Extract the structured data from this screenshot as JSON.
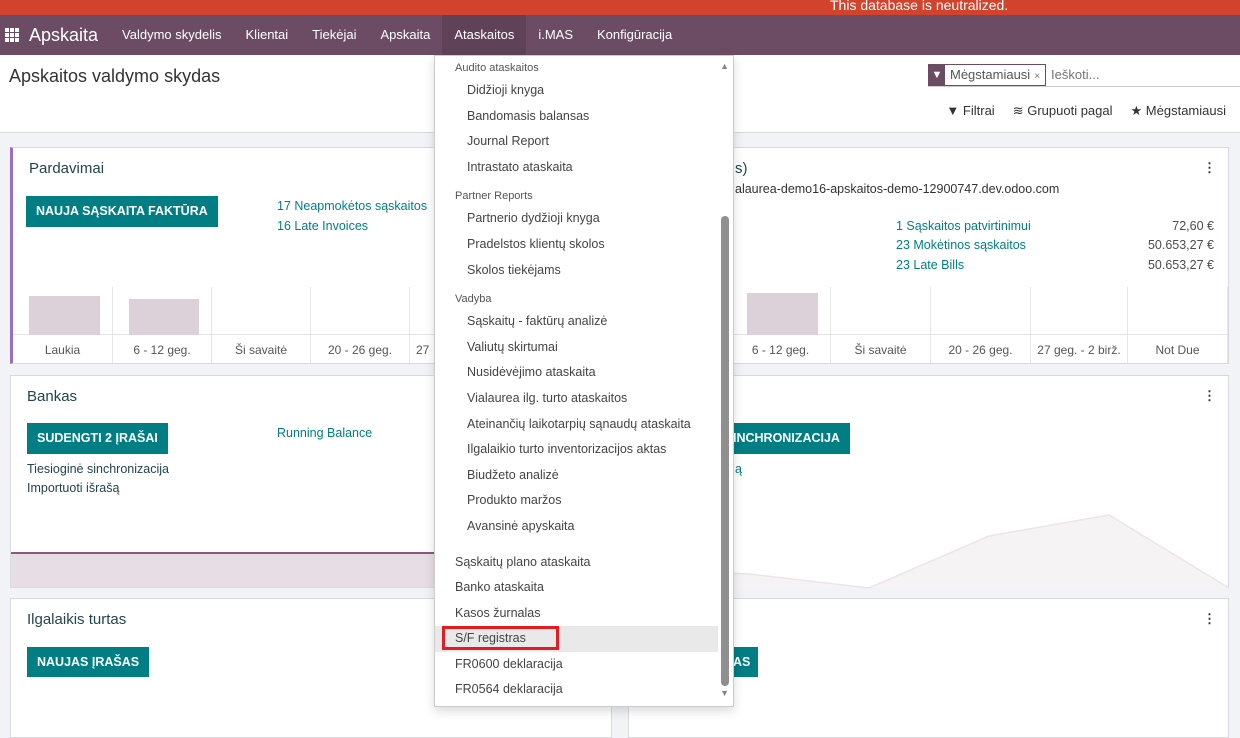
{
  "banner": "This database is neutralized.",
  "nav": {
    "brand": "Apskaita",
    "items": [
      "Valdymo skydelis",
      "Klientai",
      "Tiekėjai",
      "Apskaita",
      "Ataskaitos",
      "i.MAS",
      "Konfigūracija"
    ],
    "active": "Ataskaitos"
  },
  "page_title": "Apskaitos valdymo skydas",
  "search": {
    "facet": "Mėgstamiausi",
    "placeholder": "Ieškoti..."
  },
  "tools": {
    "filters": "Filtrai",
    "group_by": "Grupuoti pagal",
    "favorites": "Mėgstamiausi"
  },
  "sales": {
    "title": "Pardavimai",
    "button": "NAUJA SĄSKAITA FAKTŪRA",
    "links": [
      "17 Neapmokėtos sąskaitos",
      "16 Late Invoices"
    ],
    "bars": [
      "Laukia",
      "6 - 12 geg.",
      "Ši savaitė",
      "20 - 26 geg.",
      "27"
    ]
  },
  "purchases": {
    "title_partial": "s)",
    "email": "alaurea-demo16-apskaitos-demo-12900747.dev.odoo.com",
    "stats": [
      {
        "label": "1 Sąskaitos patvirtinimui",
        "value": "72,60 €"
      },
      {
        "label": "23 Mokėtinos sąskaitos",
        "value": "50.653,27 €"
      },
      {
        "label": "23 Late Bills",
        "value": "50.653,27 €"
      }
    ],
    "bars": [
      "6 - 12 geg.",
      "Ši savaitė",
      "20 - 26 geg.",
      "27 geg. - 2 birž.",
      "Not Due"
    ]
  },
  "bank": {
    "title": "Bankas",
    "button": "SUDENGTI 2 ĮRAŠAI",
    "running": "Running Balance",
    "links": [
      "Tiesioginė sinchronizacija",
      "Importuoti išrašą"
    ]
  },
  "bank2": {
    "button_partial": "INCHRONIZACIJA",
    "link_partial": "ą"
  },
  "assets": {
    "title": "Ilgalaikis turtas",
    "button": "NAUJAS ĮRAŠAS"
  },
  "assets2": {
    "button_partial": "AS"
  },
  "menu": {
    "sections": [
      {
        "header": "Audito ataskaitos",
        "items": [
          "Didžioji knyga",
          "Bandomasis balansas",
          "Journal Report",
          "Intrastato ataskaita"
        ]
      },
      {
        "header": "Partner Reports",
        "items": [
          "Partnerio dydžioji knyga",
          "Pradelstos klientų skolos",
          "Skolos tiekėjams"
        ]
      },
      {
        "header": "Vadyba",
        "items": [
          "Sąskaitų - faktūrų analizė",
          "Valiutų skirtumai",
          "Nusidėvėjimo ataskaita",
          "Vialaurea ilg. turto ataskaitos",
          "Ateinančių laikotarpių sąnaudų ataskaita",
          "Ilgalaikio turto inventorizacijos aktas",
          "Biudžeto analizė",
          "Produkto maržos",
          "Avansinė apyskaita"
        ]
      }
    ],
    "top_items": [
      "Sąskaitų plano ataskaita",
      "Banko ataskaita",
      "Kasos žurnalas",
      "S/F registras",
      "FR0600 deklaracija",
      "FR0564 deklaracija"
    ],
    "highlighted": "S/F registras"
  },
  "colors": {
    "nav": "#6b4c64",
    "accent": "#017e84",
    "banner": "#d1432c",
    "highlight": "#e31b23"
  }
}
